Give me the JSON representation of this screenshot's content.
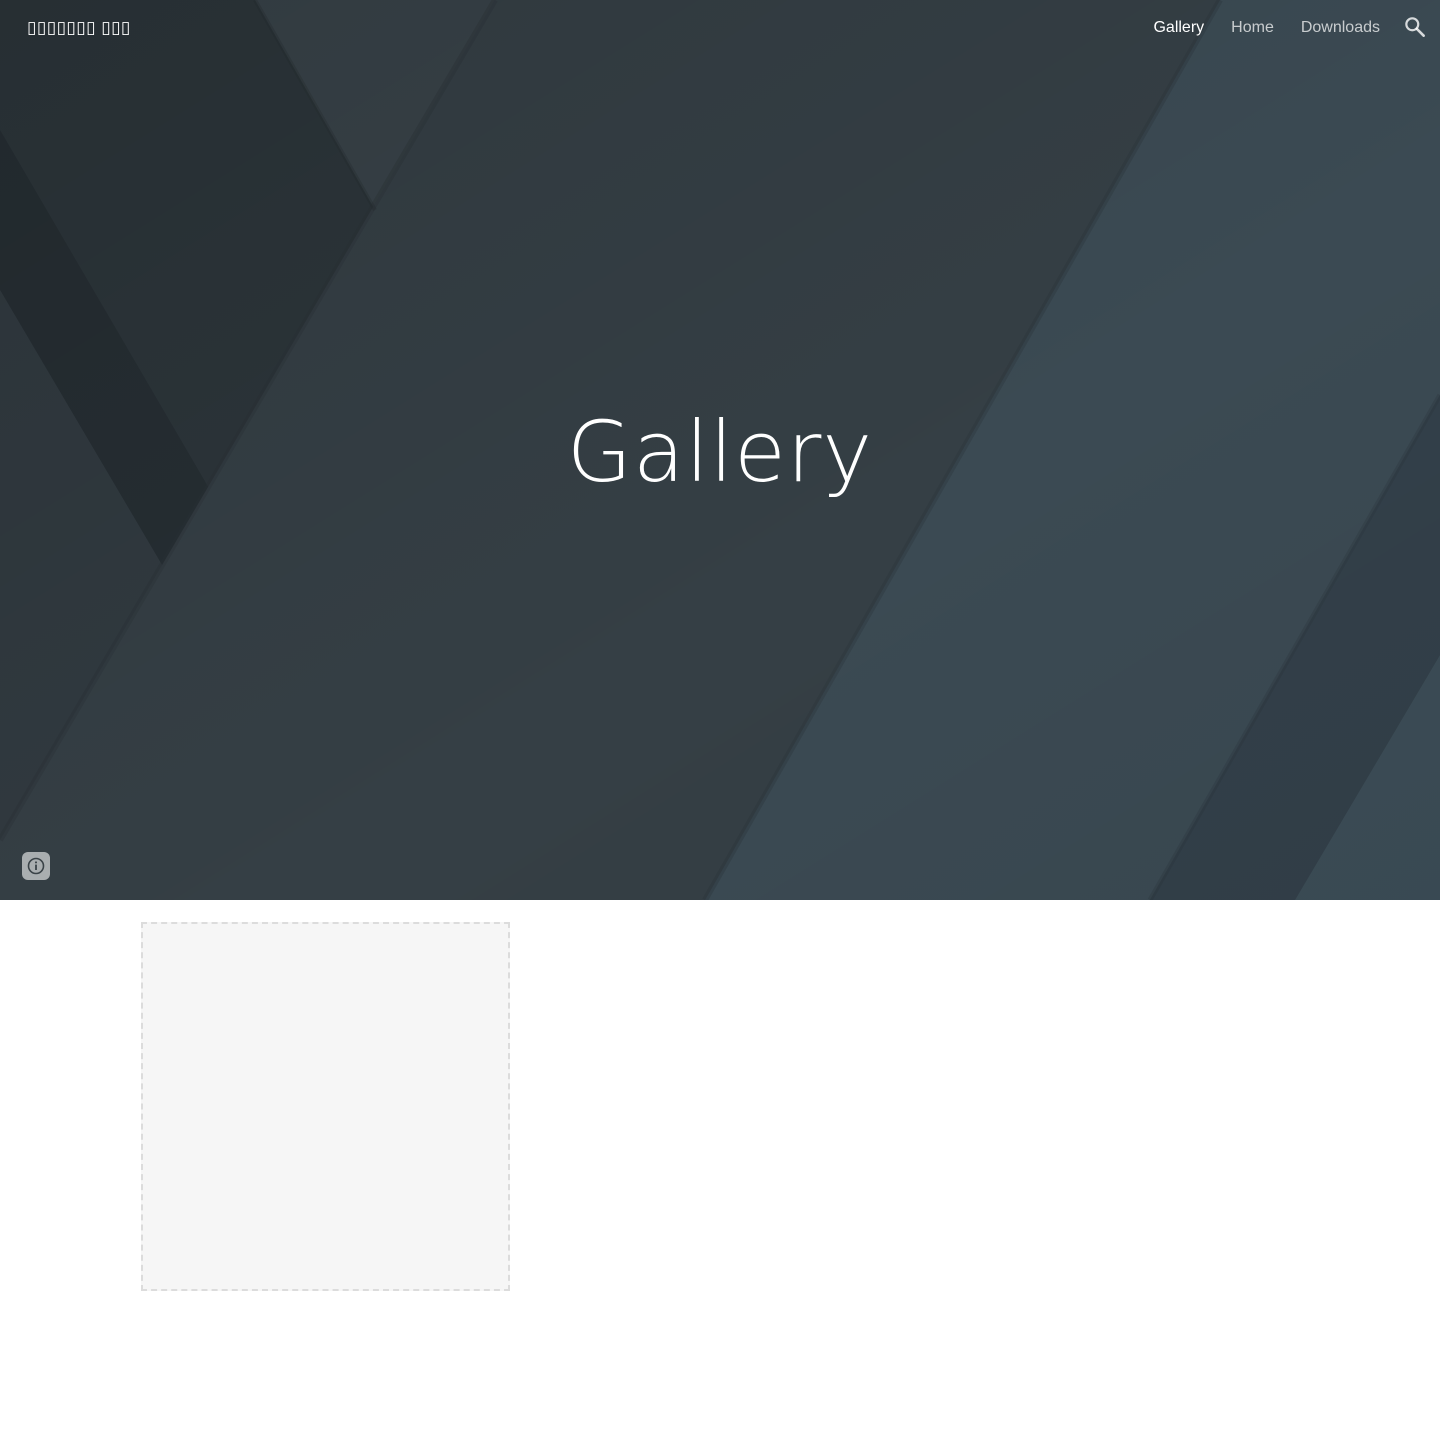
{
  "header": {
    "site_title": "▯▯▯▯▯▯▯ ▯▯▯",
    "nav": [
      {
        "label": "Gallery",
        "active": true
      },
      {
        "label": "Home",
        "active": false
      },
      {
        "label": "Downloads",
        "active": false
      }
    ],
    "search_icon": "search-icon"
  },
  "hero": {
    "title": "Gallery",
    "info_icon": "info-icon"
  },
  "colors": {
    "hero_base": "#353f45",
    "hero_dark": "#2b3338",
    "hero_teal": "#3c4c55",
    "text": "#ffffff",
    "placeholder_bg": "#f6f6f6",
    "placeholder_border": "#dcdcdc"
  }
}
